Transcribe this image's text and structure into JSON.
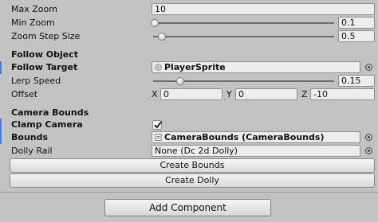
{
  "fields": {
    "max_zoom": {
      "label": "Max Zoom",
      "value": "10"
    },
    "min_zoom": {
      "label": "Min Zoom",
      "value": "0.1",
      "level": 0.01
    },
    "zoom_step_size": {
      "label": "Zoom Step Size",
      "value": "0.5",
      "level": 0.05
    }
  },
  "follow_object": {
    "header": "Follow Object",
    "follow_target": {
      "label": "Follow Target",
      "value": "PlayerSprite",
      "icon": "sprite-object-icon"
    },
    "lerp_speed": {
      "label": "Lerp Speed",
      "value": "0.15",
      "level": 0.15
    },
    "offset": {
      "label": "Offset",
      "x_label": "X",
      "x": "0",
      "y_label": "Y",
      "y": "0",
      "z_label": "Z",
      "z": "-10"
    }
  },
  "camera_bounds": {
    "header": "Camera Bounds",
    "clamp_camera": {
      "label": "Clamp Camera",
      "checked": true
    },
    "bounds": {
      "label": "Bounds",
      "value": "CameraBounds (CameraBounds)",
      "icon": "script-object-icon"
    },
    "dolly_rail": {
      "label": "Dolly Rail",
      "value": "None (Dc 2d Dolly)"
    }
  },
  "buttons": {
    "create_bounds": "Create Bounds",
    "create_dolly": "Create Dolly",
    "add_component": "Add Component"
  },
  "colors": {
    "background": "#c2c2c2",
    "modified_marker": "#3f7fd6",
    "field_background": "#ececec"
  }
}
